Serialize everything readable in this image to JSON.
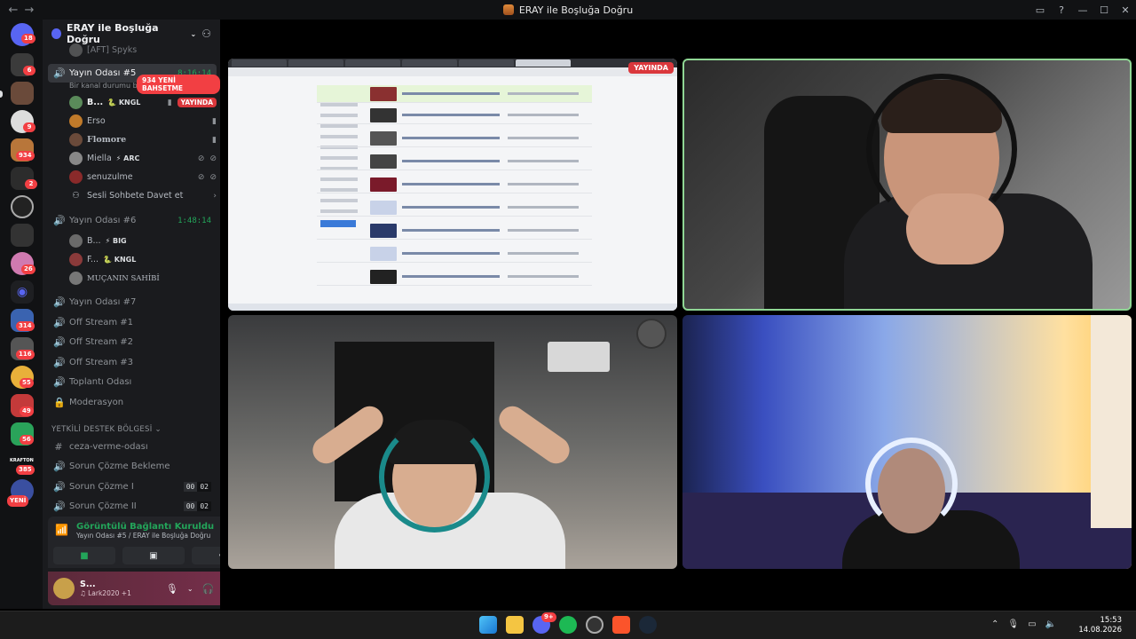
{
  "window": {
    "title": "ERAY ile Boşluğa Doğru",
    "back": "←",
    "forward": "→"
  },
  "rail": {
    "badges": [
      "18",
      "6",
      "9",
      "934",
      "2",
      "26",
      "314",
      "116",
      "55",
      "49",
      "56",
      "385"
    ],
    "new_label": "YENİ",
    "krafton_label": "KRAFTON"
  },
  "guild": {
    "name": "ERAY ile Boşluğa Doğru",
    "new_mentions": "934 YENİ BAHSETME"
  },
  "channels": {
    "partial_user": "[AFT] Spyks",
    "room5": {
      "name": "Yayın Odası #5",
      "time": "8:16:14",
      "status": "Bir kanal durumu belirle",
      "users": [
        {
          "name": "B...",
          "tag": "🐍 KNGL",
          "live": "YAYINDA"
        },
        {
          "name": "Erso"
        },
        {
          "name": "Flomore"
        },
        {
          "name": "Miella",
          "tag": "⚡ ARC"
        },
        {
          "name": "senuzulme"
        }
      ],
      "invite": "Sesli Sohbete Davet et"
    },
    "room6": {
      "name": "Yayın Odası #6",
      "time": "1:48:14",
      "users": [
        {
          "name": "B...",
          "tag": "⚡ BIG"
        },
        {
          "name": "F...",
          "tag": "🐍 KNGL"
        },
        {
          "name": "MUÇANIN SAHİBİ"
        }
      ]
    },
    "others": [
      "Yayın Odası #7",
      "Off Stream #1",
      "Off Stream #2",
      "Off Stream #3",
      "Toplantı Odası",
      "Moderasyon"
    ],
    "category": "YETKİLİ DESTEK BÖLGESİ",
    "support": [
      {
        "name": "ceza-verme-odası",
        "type": "text"
      },
      {
        "name": "Sorun Çözme Bekleme",
        "type": "voice"
      },
      {
        "name": "Sorun Çözme I",
        "type": "voice",
        "count": [
          "00",
          "02"
        ]
      },
      {
        "name": "Sorun Çözme II",
        "type": "voice",
        "count": [
          "00",
          "02"
        ]
      }
    ]
  },
  "voice": {
    "status": "Görüntülü Bağlantı Kuruldu",
    "where": "Yayın Odası #5 / ERAY ile Boşluğa Doğru"
  },
  "user": {
    "name": "S...",
    "status": "♫ Lark2020 +1"
  },
  "stage": {
    "live_label": "YAYINDA"
  },
  "taskbar": {
    "discord_badge": "9+",
    "time": "15:53",
    "date": "14.08.2026"
  }
}
